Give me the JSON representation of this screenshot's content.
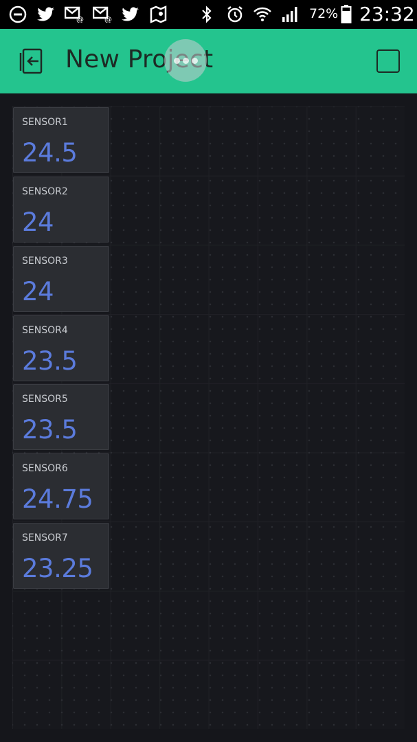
{
  "status_bar": {
    "battery_percent": "72%",
    "time": "23:32",
    "icons": [
      "do-not-disturb-icon",
      "twitter-icon",
      "mail-at-icon",
      "mail-at-icon",
      "twitter-icon",
      "map-icon",
      "bluetooth-icon",
      "alarm-icon",
      "wifi-icon",
      "signal-icon",
      "battery-icon"
    ]
  },
  "app_bar": {
    "title": "New Project",
    "color": "#24c48e"
  },
  "widgets": [
    {
      "label": "SENSOR1",
      "value": "24.5"
    },
    {
      "label": "SENSOR2",
      "value": "24"
    },
    {
      "label": "SENSOR3",
      "value": "24"
    },
    {
      "label": "SENSOR4",
      "value": "23.5"
    },
    {
      "label": "SENSOR5",
      "value": "23.5"
    },
    {
      "label": "SENSOR6",
      "value": "24.75"
    },
    {
      "label": "SENSOR7",
      "value": "23.25"
    }
  ],
  "colors": {
    "background": "#15161b",
    "widget_background": "#2b2d32",
    "value_color": "#5b7bdc",
    "label_color": "#c8cbd0"
  }
}
